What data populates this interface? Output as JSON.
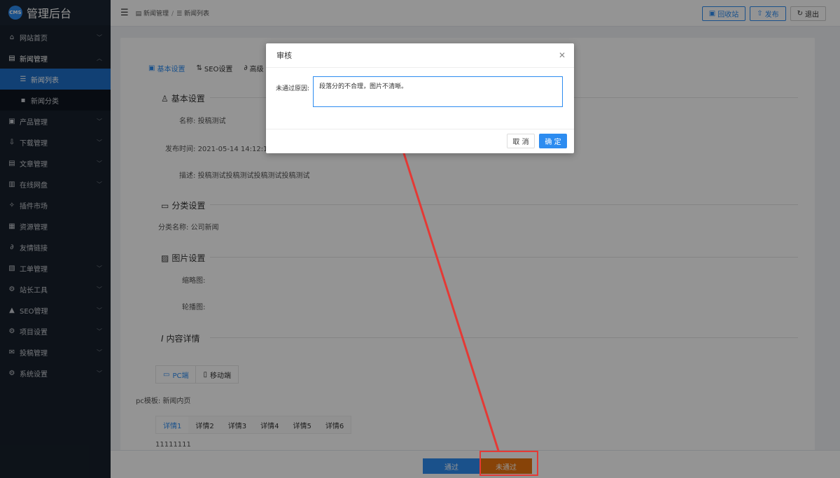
{
  "brand": {
    "logo": "CMS",
    "title": "管理后台"
  },
  "sidebar": {
    "items": [
      {
        "label": "网站首页",
        "icon": "home-icon",
        "glyph": "⌂"
      },
      {
        "label": "新闻管理",
        "icon": "news-icon",
        "glyph": "▤"
      },
      {
        "label": "新闻列表",
        "icon": "list-icon",
        "glyph": "☰"
      },
      {
        "label": "新闻分类",
        "icon": "grid-icon",
        "glyph": "▪"
      },
      {
        "label": "产品管理",
        "icon": "product-icon",
        "glyph": "▣"
      },
      {
        "label": "下载管理",
        "icon": "download-icon",
        "glyph": "⇩"
      },
      {
        "label": "文章管理",
        "icon": "article-icon",
        "glyph": "▤"
      },
      {
        "label": "在线网盘",
        "icon": "disk-icon",
        "glyph": "▥"
      },
      {
        "label": "插件市场",
        "icon": "plugin-icon",
        "glyph": "✧"
      },
      {
        "label": "资源管理",
        "icon": "resource-icon",
        "glyph": "▦"
      },
      {
        "label": "友情链接",
        "icon": "link-icon",
        "glyph": "∂"
      },
      {
        "label": "工单管理",
        "icon": "ticket-icon",
        "glyph": "▧"
      },
      {
        "label": "站长工具",
        "icon": "tools-icon",
        "glyph": "⚙"
      },
      {
        "label": "SEO管理",
        "icon": "seo-icon",
        "glyph": "▲"
      },
      {
        "label": "项目设置",
        "icon": "settings-icon",
        "glyph": "⚙"
      },
      {
        "label": "投稿管理",
        "icon": "mail-icon",
        "glyph": "✉"
      },
      {
        "label": "系统设置",
        "icon": "system-icon",
        "glyph": "⚙"
      }
    ]
  },
  "header": {
    "breadcrumb": [
      "新闻管理",
      "新闻列表"
    ],
    "buttons": {
      "recycle": "回收站",
      "publish": "发布",
      "logout": "退出"
    }
  },
  "content": {
    "tabs": [
      "基本设置",
      "SEO设置",
      "高级"
    ],
    "sections": {
      "basic": "基本设置",
      "category": "分类设置",
      "image": "图片设置",
      "detail": "内容详情"
    },
    "fields": {
      "name_label": "名称:",
      "name_value": "投稿测试",
      "time_label": "发布时间:",
      "time_value": "2021-05-14 14:12:13",
      "desc_label": "描述:",
      "desc_value": "投稿测试投稿测试投稿测试投稿测试",
      "cat_label": "分类名称:",
      "cat_value": "公司新闻",
      "thumb_label": "缩略图:",
      "carousel_label": "轮播图:",
      "tpl_label": "pc模板:",
      "tpl_value": "新闻内页",
      "body_text": "11111111"
    },
    "device_tabs": [
      "PC端",
      "移动端"
    ],
    "detail_tabs": [
      "详情1",
      "详情2",
      "详情3",
      "详情4",
      "详情5",
      "详情6"
    ]
  },
  "footer": {
    "pass": "通过",
    "reject": "未通过"
  },
  "modal": {
    "title": "审核",
    "label": "未通过原因:",
    "value": "段落分的不合理，图片不清晰。",
    "cancel": "取 消",
    "ok": "确 定"
  },
  "colors": {
    "primary": "#2d8cf0",
    "reject": "#e8740e",
    "annotation": "#e53935",
    "sidebar": "#17202b"
  }
}
